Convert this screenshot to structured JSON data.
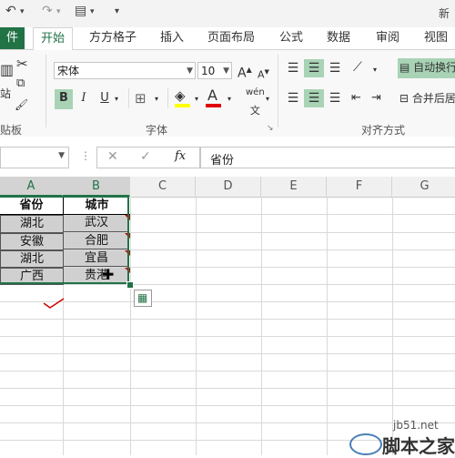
{
  "window": {
    "title_partial": "新"
  },
  "tabs": {
    "file": "件",
    "items": [
      "开始",
      "方方格子",
      "插入",
      "页面布局",
      "公式",
      "数据",
      "审阅",
      "视图"
    ]
  },
  "ribbon": {
    "clipboard": {
      "paste_partial": "站",
      "label_partial": "贴板"
    },
    "font": {
      "name": "宋体",
      "size": "10",
      "grow": "A",
      "shrink": "A",
      "bold": "B",
      "italic": "I",
      "underline": "U",
      "phonetic": "wén",
      "label": "字体"
    },
    "alignment": {
      "wrap_text": "自动换行",
      "merge": "合并后居中",
      "label": "对齐方式"
    }
  },
  "formula_bar": {
    "fx": "fx",
    "content": "省份"
  },
  "columns": [
    "A",
    "B",
    "C",
    "D",
    "E",
    "F",
    "G"
  ],
  "table": {
    "headers": [
      "省份",
      "城市"
    ],
    "rows": [
      [
        "湖北",
        "武汉"
      ],
      [
        "安徽",
        "合肥"
      ],
      [
        "湖北",
        "宜昌"
      ],
      [
        "广西",
        "贵港"
      ]
    ]
  },
  "watermark": {
    "site": "jb51.net",
    "name": "脚本之家"
  },
  "colors": {
    "excel_green": "#217346",
    "selection_grey": "#d0d0d0",
    "comment_red": "#c00000"
  }
}
